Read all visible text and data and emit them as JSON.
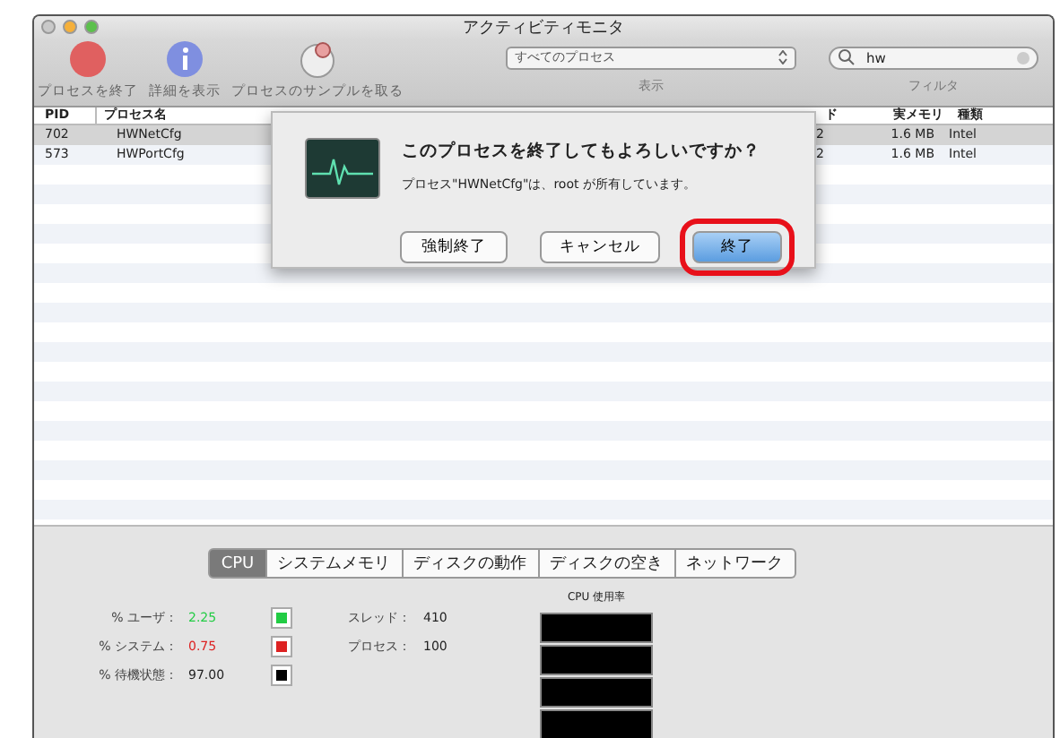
{
  "window": {
    "title": "アクティビティモニタ"
  },
  "toolbar": {
    "buttons": [
      {
        "label": "プロセスを終了",
        "kind": "stop"
      },
      {
        "label": "詳細を表示",
        "kind": "info"
      },
      {
        "label": "プロセスのサンプルを取る",
        "kind": "sample"
      }
    ],
    "show": {
      "value": "すべてのプロセス",
      "label": "表示"
    },
    "filter": {
      "value": "hw",
      "label": "フィルタ"
    }
  },
  "table": {
    "columns": [
      "PID",
      "プロセス名",
      "ド",
      "実メモリ",
      "種類"
    ],
    "rows": [
      {
        "pid": "702",
        "name": "HWNetCfg",
        "threads": "2",
        "memory": "1.6 MB",
        "kind": "Intel",
        "selected": true
      },
      {
        "pid": "573",
        "name": "HWPortCfg",
        "threads": "2",
        "memory": "1.6 MB",
        "kind": "Intel",
        "selected": false
      }
    ]
  },
  "dialog": {
    "title": "このプロセスを終了してもよろしいですか？",
    "message": "プロセス\"HWNetCfg\"は、root が所有しています。",
    "buttons": [
      {
        "label": "強制終了",
        "default": false,
        "highlighted": false
      },
      {
        "label": "キャンセル",
        "default": false,
        "highlighted": false
      },
      {
        "label": "終了",
        "default": true,
        "highlighted": true
      }
    ]
  },
  "bottom": {
    "tabs": [
      {
        "label": "CPU",
        "selected": true
      },
      {
        "label": "システムメモリ",
        "selected": false
      },
      {
        "label": "ディスクの動作",
        "selected": false
      },
      {
        "label": "ディスクの空き",
        "selected": false
      },
      {
        "label": "ネットワーク",
        "selected": false
      }
    ],
    "stats": [
      {
        "label": "% ユーザ：",
        "value": "2.25",
        "color": "#22cc44"
      },
      {
        "label": "% システム：",
        "value": "0.75",
        "color": "#dd2222"
      },
      {
        "label": "% 待機状態：",
        "value": "97.00",
        "color": "#000000"
      }
    ],
    "counts": [
      {
        "label": "スレッド：",
        "value": "410"
      },
      {
        "label": "プロセス：",
        "value": "100"
      }
    ],
    "graph": {
      "title": "CPU 使用率"
    }
  }
}
